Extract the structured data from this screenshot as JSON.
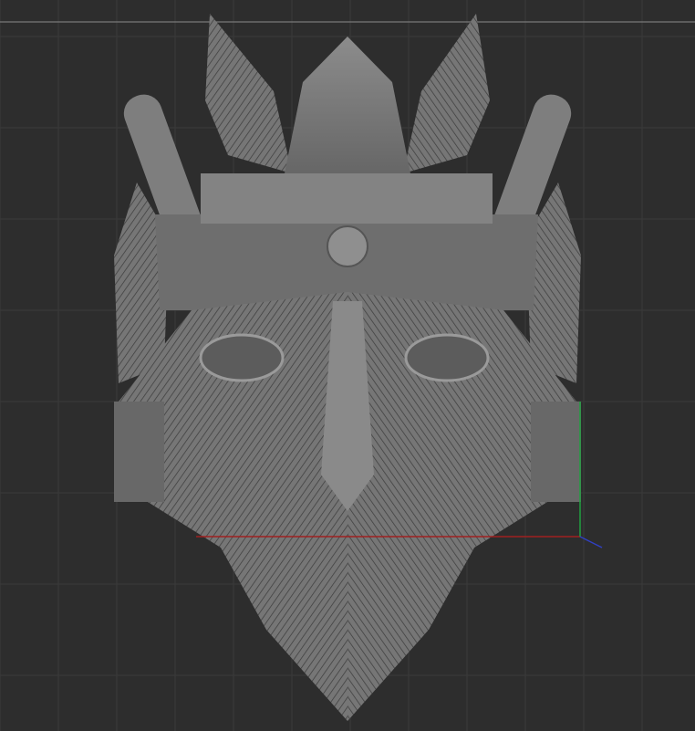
{
  "viewport": {
    "background_color": "#2d2d2d",
    "grid_color": "#3a3a3a",
    "frame_line_color": "#8a8a8a",
    "model_color": "#7a7a7a",
    "axis_colors": {
      "x": "#a02020",
      "y": "#20a040",
      "z": "#3040c0"
    },
    "model_icon": "sculpted-mask-model"
  }
}
